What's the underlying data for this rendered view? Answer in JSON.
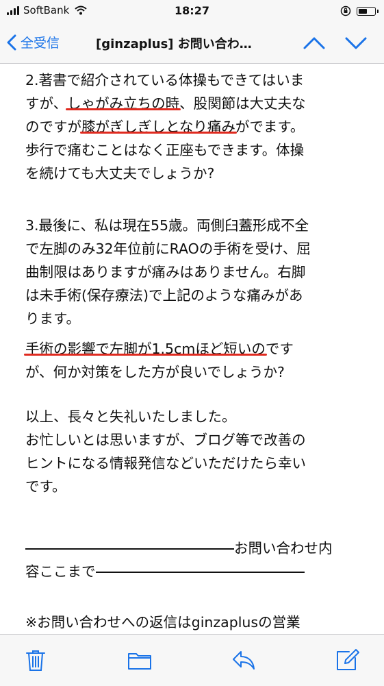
{
  "status_bar": {
    "carrier": "SoftBank",
    "time": "18:27",
    "battery_level": 0.55,
    "icons": [
      "signal-icon",
      "wifi-icon",
      "rotation-lock-icon",
      "battery-icon"
    ]
  },
  "nav": {
    "back_label": "全受信",
    "title": "[ginzaplus] お問い合わ…",
    "icons": [
      "chevron-left-icon",
      "chevron-up-icon",
      "chevron-down-icon"
    ]
  },
  "body": {
    "p2": {
      "l1": "2.著書で紹介されている体操もできてはいま",
      "l2a": "すが、",
      "l2hl": "しゃがみ立ちの時",
      "l2b": "、股関節は大丈夫な",
      "l3a": "のですが",
      "l3hl": "膝がぎしぎしとなり痛み",
      "l3b": "がでます。",
      "l4": "歩行で痛むことはなく正座もできます。体操",
      "l5": "を続けても大丈夫でしょうか?"
    },
    "p3": {
      "l1": "3.最後に、私は現在55歳。両側臼蓋形成不全",
      "l2": "で左脚のみ32年位前にRAOの手術を受け、屈",
      "l3": "曲制限はありますが痛みはありません。右脚",
      "l4": "は未手術(保存療法)で上記のような痛みがあ",
      "l5": "ります。",
      "l6hl": "手術の影響で左脚が1.5cmほど短いの",
      "l6b": "です",
      "l7": "が、何か対策をした方が良いでしょうか?"
    },
    "p4": {
      "l1": "以上、長々と失礼いたしました。",
      "l2": "お忙しいとは思いますが、ブログ等で改善の",
      "l3": "ヒントになる情報発信などいただけたら幸い",
      "l4": "です。"
    },
    "divider": {
      "l1": "お問い合わせ内",
      "l2": "容ここまで"
    },
    "footer_note": "※お問い合わせへの返信はginzaplusの営業"
  },
  "toolbar": {
    "icons": [
      "trash-icon",
      "folder-icon",
      "reply-icon",
      "compose-icon"
    ]
  },
  "colors": {
    "accent": "#1a73e8",
    "underline": "#e02a1f"
  }
}
